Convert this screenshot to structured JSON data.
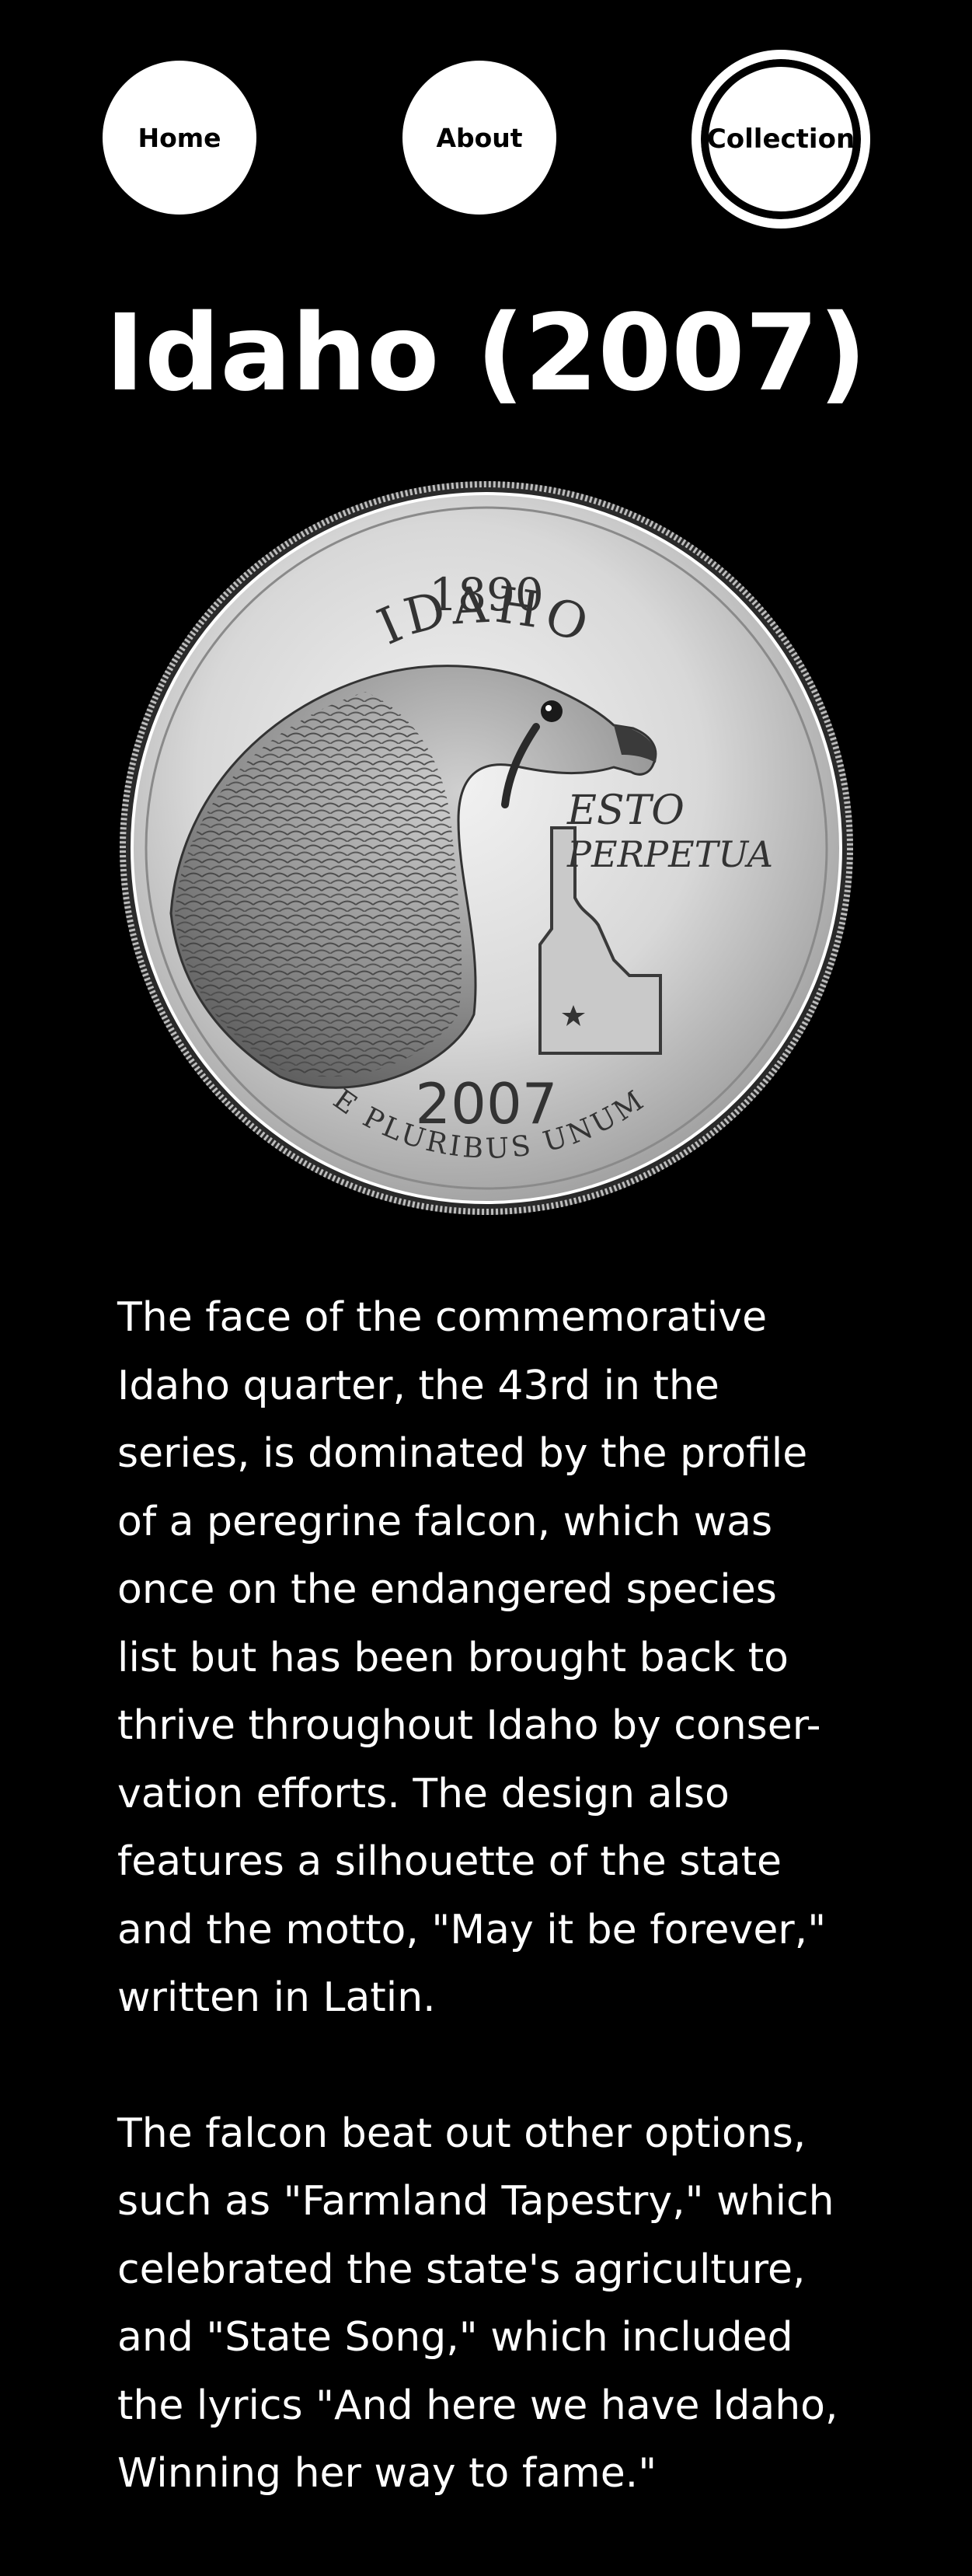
{
  "nav": {
    "home_label": "Home",
    "about_label": "About",
    "collection_label": "Collection"
  },
  "page": {
    "title": "Idaho (2007)"
  },
  "coin": {
    "state_name": "IDAHO",
    "statehood_year": "1890",
    "motto_line1": "ESTO",
    "motto_line2": "PERPETUA",
    "mint_year": "2007",
    "legend": "E PLURIBUS UNUM"
  },
  "content": {
    "paragraph1": "The face of the commemorative\nIdaho quarter, the 43rd in the\nseries, is dominated by the profile\nof a peregrine falcon, which was\nonce on the endangered species\nlist but has been brought back to\nthrive throughout Idaho by conser-\nvation efforts. The design also\nfeatures a silhouette of the state\nand the motto, \"May it be forever,\"\nwritten in Latin.",
    "paragraph2": "The falcon beat out other options,\nsuch as \"Farmland Tapestry,\" which\ncelebrated the state's agriculture,\nand \"State Song,\" which included\nthe lyrics \"And here we have Idaho,\nWinning her way to fame.\""
  },
  "colors": {
    "background": "#000000",
    "text": "#ffffff",
    "nav_button_bg": "#ffffff",
    "nav_button_text": "#000000"
  }
}
